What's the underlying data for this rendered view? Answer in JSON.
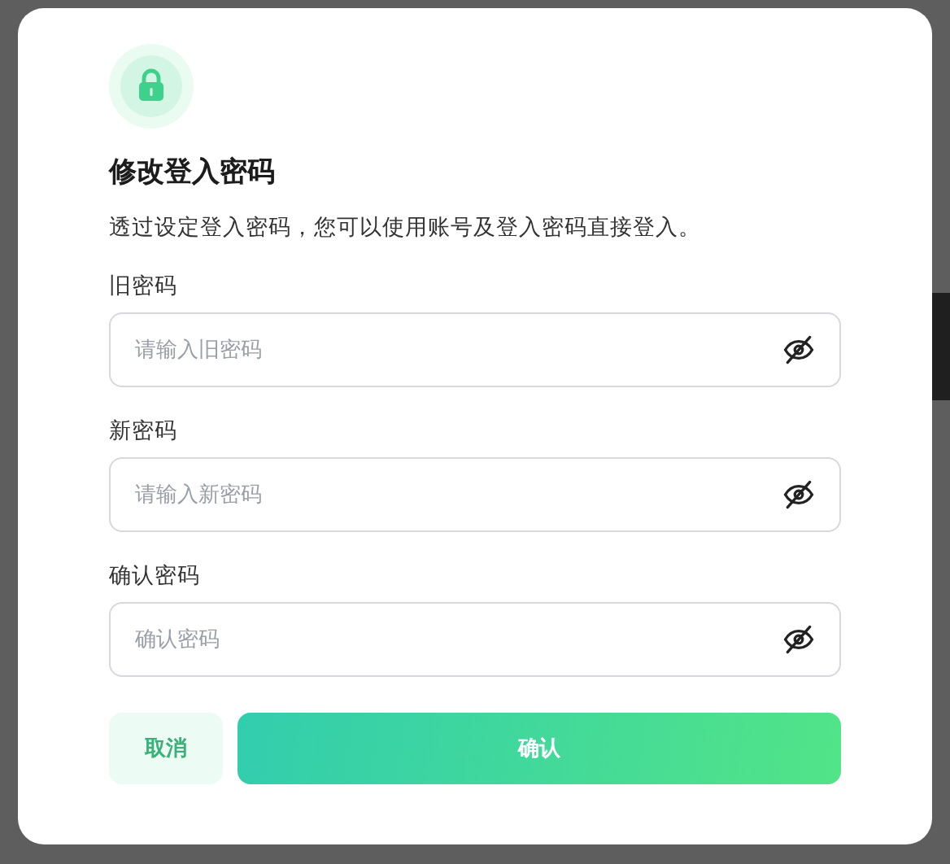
{
  "dialog": {
    "title": "修改登入密码",
    "description": "透过设定登入密码，您可以使用账号及登入密码直接登入。",
    "fields": [
      {
        "label": "旧密码",
        "placeholder": "请输入旧密码",
        "visible": false
      },
      {
        "label": "新密码",
        "placeholder": "请输入新密码",
        "visible": false
      },
      {
        "label": "确认密码",
        "placeholder": "确认密码",
        "visible": false
      }
    ],
    "buttons": [
      {
        "label": "取消",
        "kind": "secondary"
      },
      {
        "label": "确认",
        "kind": "primary"
      }
    ]
  }
}
